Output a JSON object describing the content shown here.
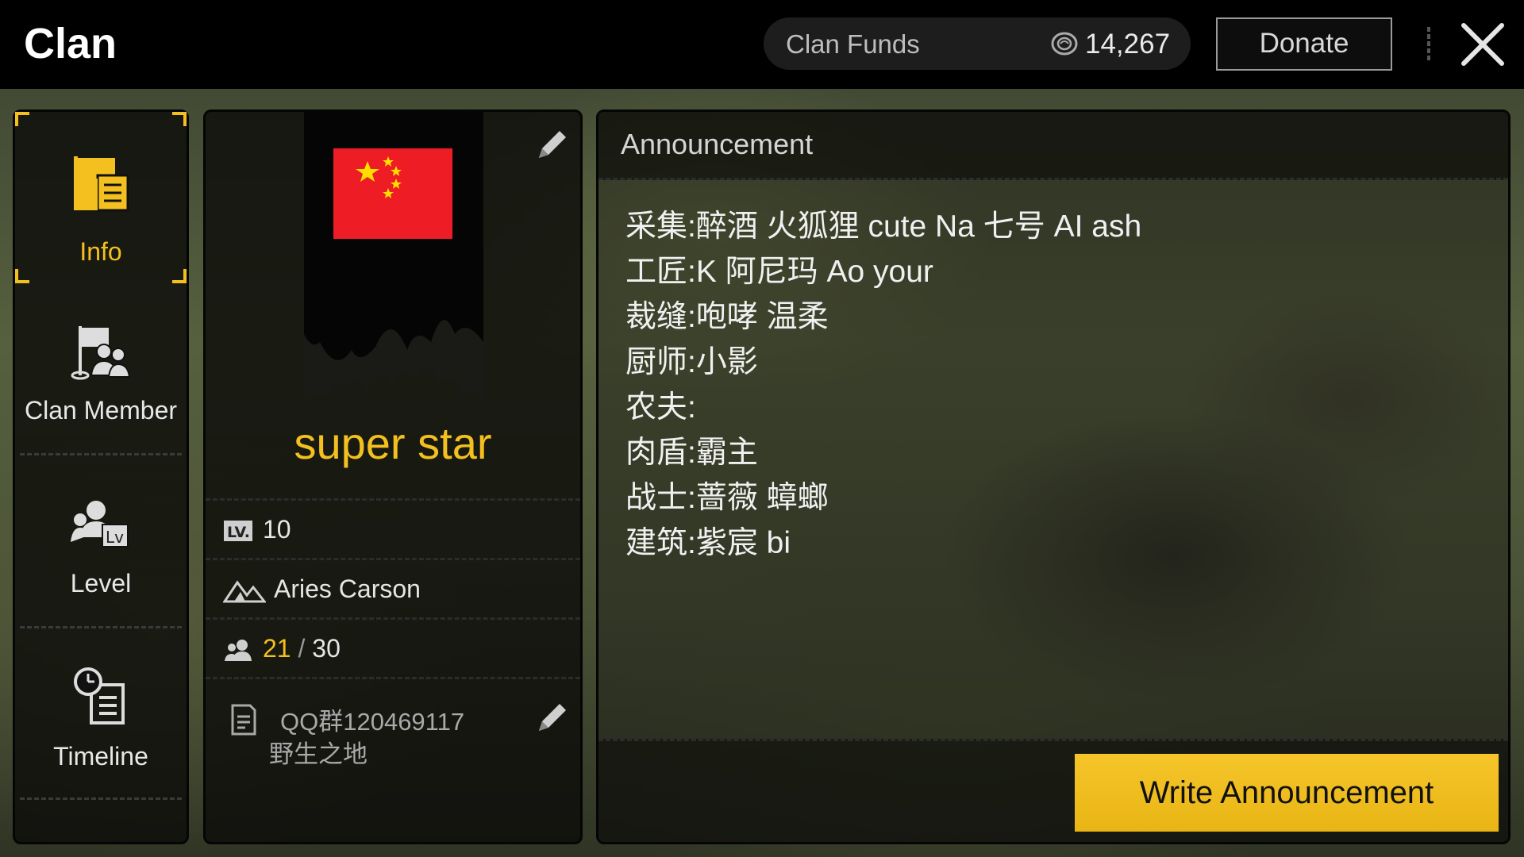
{
  "header": {
    "title": "Clan",
    "funds_label": "Clan Funds",
    "funds_value": "14,267",
    "donate_label": "Donate"
  },
  "sidebar": {
    "items": [
      {
        "label": "Info",
        "icon": "info-flag-document-icon",
        "active": true
      },
      {
        "label": "Clan Member",
        "icon": "clan-member-icon",
        "active": false
      },
      {
        "label": "Level",
        "icon": "level-icon",
        "active": false
      },
      {
        "label": "Timeline",
        "icon": "timeline-clock-icon",
        "active": false
      }
    ]
  },
  "clan": {
    "name": "super star",
    "flag": "china-flag",
    "level_value": "10",
    "leader": "Aries Carson",
    "members_current": "21",
    "members_sep": " / ",
    "members_max": "30",
    "description_line1": "QQ群120469117",
    "description_line2": "野生之地"
  },
  "announcement": {
    "title": "Announcement",
    "lines": [
      "采集:醉酒 火狐狸 cute Na 七号 AI ash",
      "工匠:K 阿尼玛 Ao your",
      "裁缝:咆哮 温柔",
      "厨师:小影",
      "农夫:",
      "肉盾:霸主",
      "战士:蔷薇 蟑螂",
      "建筑:紫宸 bi"
    ],
    "write_button_label": "Write Announcement"
  },
  "colors": {
    "accent_gold": "#f3c01f",
    "button_yellow": "#f6c52a",
    "flag_red": "#ee1c25",
    "flag_yellow": "#ffde00"
  }
}
